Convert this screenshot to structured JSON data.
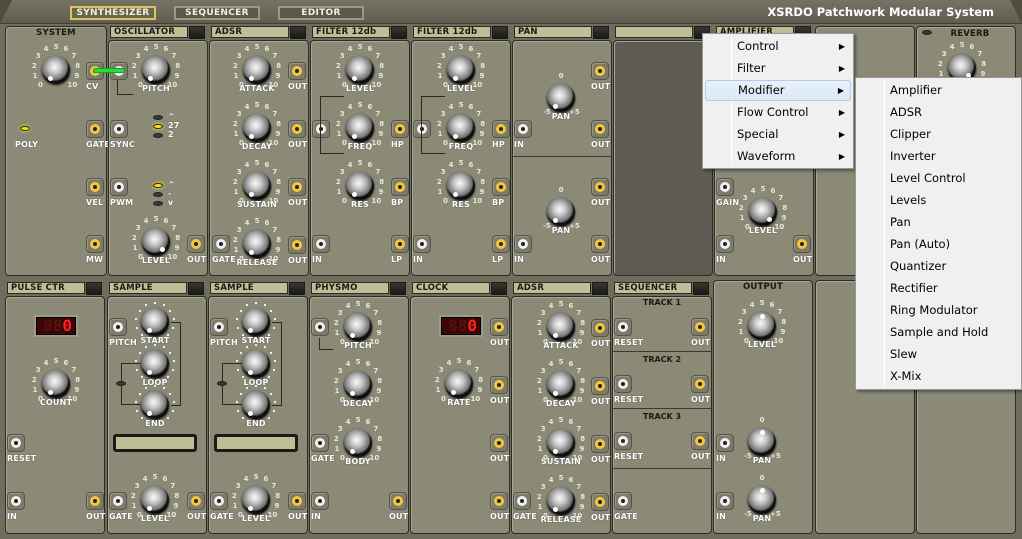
{
  "app": {
    "title": "XSRDO Patchwork Modular System",
    "nav": [
      {
        "label": "SYNTHESIZER",
        "active": true
      },
      {
        "label": "SEQUENCER",
        "active": false
      },
      {
        "label": "EDITOR",
        "active": false
      }
    ]
  },
  "colors": {
    "panel": "#8b8a77",
    "header": "#bebf98",
    "jack_out": "#f5c83a",
    "jack_in": "#f0f0f0",
    "led_on": "#ffe020",
    "display": "#ff2020"
  },
  "knob_scale": [
    "0",
    "1",
    "2",
    "3",
    "4",
    "5",
    "6",
    "7",
    "8",
    "9",
    "10"
  ],
  "pan_scale": {
    "left": "-5",
    "center": "0",
    "right": "+5"
  },
  "row1": {
    "system": {
      "title": "SYSTEM",
      "poly": "POLY",
      "cv": "CV",
      "gate": "GATE",
      "vel": "VEL",
      "mw": "MW"
    },
    "oscillator": {
      "title": "OSCILLATOR",
      "pitch": "PITCH",
      "sync": "SYNC",
      "pwm": "PWM",
      "level": "LEVEL",
      "out": "OUT",
      "octave_leds": [
        "^",
        "27",
        "2"
      ],
      "wave_leds": [
        "^",
        "-",
        "v"
      ]
    },
    "adsr": {
      "title": "ADSR",
      "knobs": [
        "ATTACK",
        "DECAY",
        "SUSTAIN",
        "RELEASE"
      ],
      "out": "OUT",
      "gate": "GATE"
    },
    "filter1": {
      "title": "FILTER 12db",
      "knobs": [
        "LEVEL",
        "FREQ",
        "RES"
      ],
      "outs": [
        "HP",
        "BP",
        "LP"
      ],
      "in": "IN"
    },
    "filter2": {
      "title": "FILTER 12db",
      "knobs": [
        "LEVEL",
        "FREQ",
        "RES"
      ],
      "outs": [
        "HP",
        "BP",
        "LP"
      ],
      "in": "IN"
    },
    "pan": {
      "title": "PAN",
      "knob": "PAN",
      "in": "IN",
      "out": "OUT"
    },
    "empty": {
      "title": ""
    },
    "amplifier": {
      "title": "AMPLIFIER",
      "gain": "GAIN",
      "level": "LEVEL",
      "in": "IN",
      "out": "OUT"
    },
    "reverb": {
      "title": "REVERB"
    }
  },
  "row2": {
    "pulse_ctr": {
      "title": "PULSE CTR",
      "display": "0",
      "count": "COUNT",
      "reset": "RESET",
      "in": "IN",
      "out": "OUT"
    },
    "sample1": {
      "title": "SAMPLE",
      "pitch": "PITCH",
      "knobs": [
        "START",
        "LOOP",
        "END"
      ],
      "gate": "GATE",
      "level": "LEVEL",
      "out": "OUT"
    },
    "sample2": {
      "title": "SAMPLE",
      "pitch": "PITCH",
      "knobs": [
        "START",
        "LOOP",
        "END"
      ],
      "gate": "GATE",
      "level": "LEVEL",
      "out": "OUT"
    },
    "physmo": {
      "title": "PHYSMO",
      "knobs": [
        "PITCH",
        "DECAY",
        "BODY"
      ],
      "gate": "GATE",
      "in": "IN",
      "out": "OUT"
    },
    "clock": {
      "title": "CLOCK",
      "display": "0",
      "rate": "RATE",
      "out": "OUT"
    },
    "adsr": {
      "title": "ADSR",
      "knobs": [
        "ATTACK",
        "DECAY",
        "SUSTAIN",
        "RELEASE"
      ],
      "out": "OUT",
      "gate": "GATE"
    },
    "sequencer": {
      "title": "SEQUENCER",
      "tracks": [
        "TRACK 1",
        "TRACK 2",
        "TRACK 3"
      ],
      "reset": "RESET",
      "out": "OUT",
      "gate": "GATE"
    },
    "output": {
      "title": "OUTPUT",
      "level": "LEVEL",
      "pan": "PAN",
      "in": "IN"
    }
  },
  "context_menu": {
    "items": [
      {
        "label": "Control",
        "submenu": true
      },
      {
        "label": "Filter",
        "submenu": true
      },
      {
        "label": "Modifier",
        "submenu": true,
        "highlighted": true
      },
      {
        "label": "Flow Control",
        "submenu": true
      },
      {
        "label": "Special",
        "submenu": true
      },
      {
        "label": "Waveform",
        "submenu": true
      }
    ],
    "arrow": "▶"
  },
  "submenu_modifier": {
    "items": [
      "Amplifier",
      "ADSR",
      "Clipper",
      "Inverter",
      "Level Control",
      "Levels",
      "Pan",
      "Pan (Auto)",
      "Quantizer",
      "Rectifier",
      "Ring Modulator",
      "Sample and Hold",
      "Slew",
      "X-Mix"
    ]
  }
}
